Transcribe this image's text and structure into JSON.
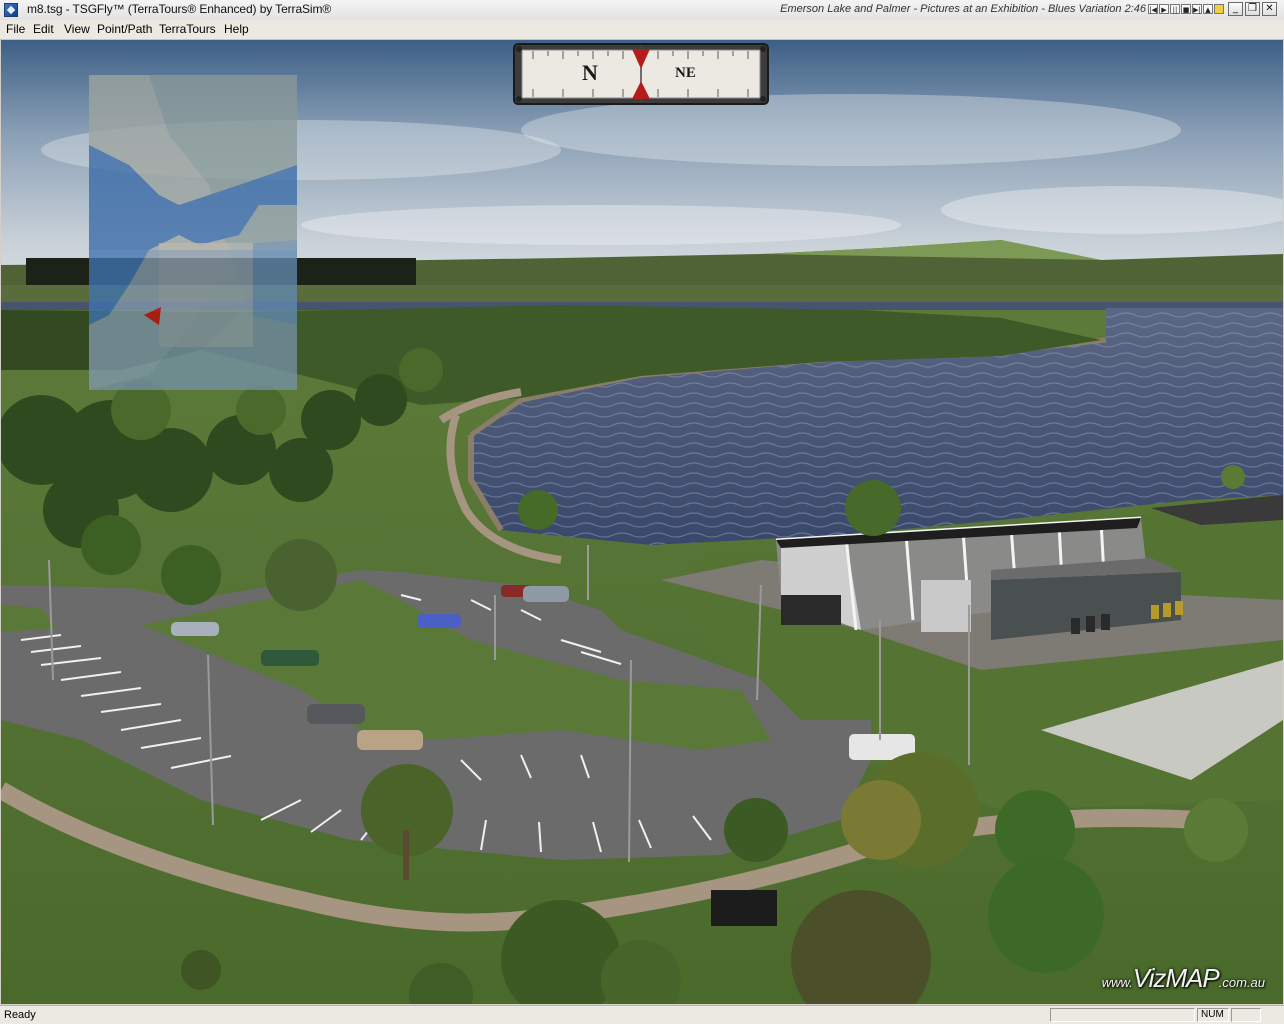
{
  "window": {
    "title": "m8.tsg - TSGFly™ (TerraTours® Enhanced) by TerraSim®",
    "media_info": "Emerson Lake and Palmer - Pictures at an Exhibition - Blues Variation  2:46",
    "media_controls": [
      "|◀",
      "▶",
      "||",
      "■",
      "▶|",
      "▲",
      "🔒"
    ],
    "controls": {
      "minimize": "_",
      "restore": "❐",
      "close": "✕"
    }
  },
  "menu": {
    "items": [
      {
        "label": "File"
      },
      {
        "label": "Edit"
      },
      {
        "label": "View"
      },
      {
        "label": "Point/Path"
      },
      {
        "label": "TerraTours"
      },
      {
        "label": "Help"
      }
    ]
  },
  "compass": {
    "primary": "N",
    "secondary": "NE"
  },
  "watermark": {
    "prefix": "www.",
    "main": "VizMAP",
    "suffix": ".com.au"
  },
  "status": {
    "text": "Ready",
    "num_indicator": "NUM"
  },
  "colors": {
    "sky_top": "#3d5f86",
    "sky_horizon": "#d9dee2",
    "water": "#3e4d6a",
    "grass": "#557333",
    "asphalt": "#6c6c6c",
    "path": "#a69580"
  }
}
